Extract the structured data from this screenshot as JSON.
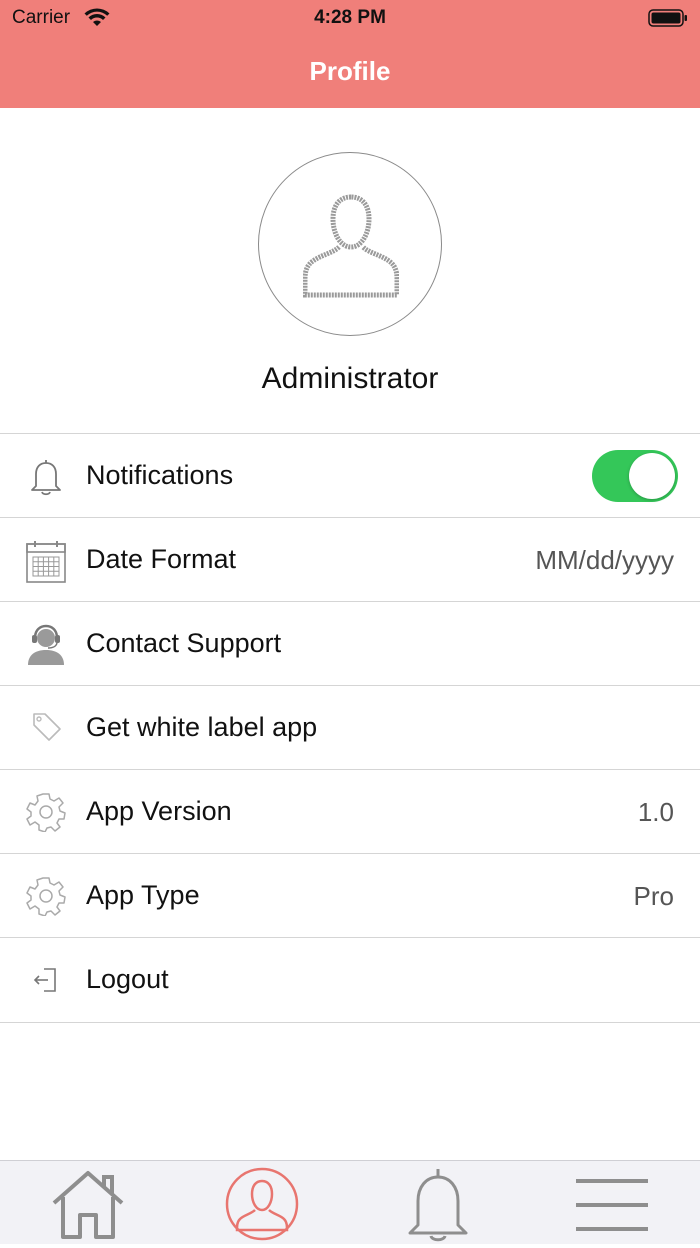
{
  "status_bar": {
    "carrier": "Carrier",
    "time": "4:28 PM"
  },
  "nav": {
    "title": "Profile",
    "background_color": "#f07f7a"
  },
  "profile": {
    "name": "Administrator",
    "avatar_icon": "user-avatar-icon"
  },
  "settings": {
    "notifications": {
      "label": "Notifications",
      "icon": "bell-icon",
      "enabled": true,
      "toggle_color": "#34c759"
    },
    "date_format": {
      "label": "Date Format",
      "value": "MM/dd/yyyy",
      "icon": "calendar-icon"
    },
    "contact_support": {
      "label": "Contact Support",
      "icon": "support-agent-icon"
    },
    "white_label": {
      "label": "Get white label app",
      "icon": "tag-icon"
    },
    "app_version": {
      "label": "App Version",
      "value": "1.0",
      "icon": "gear-icon"
    },
    "app_type": {
      "label": "App Type",
      "value": "Pro",
      "icon": "gear-icon"
    },
    "logout": {
      "label": "Logout",
      "icon": "logout-icon"
    }
  },
  "tabbar": {
    "tabs": [
      {
        "name": "home",
        "icon": "home-icon",
        "active": false
      },
      {
        "name": "profile",
        "icon": "profile-icon",
        "active": true
      },
      {
        "name": "notifications",
        "icon": "bell-icon",
        "active": false
      },
      {
        "name": "menu",
        "icon": "hamburger-menu-icon",
        "active": false
      }
    ],
    "active_color": "#e8756f",
    "inactive_color": "#8e8e8e"
  }
}
